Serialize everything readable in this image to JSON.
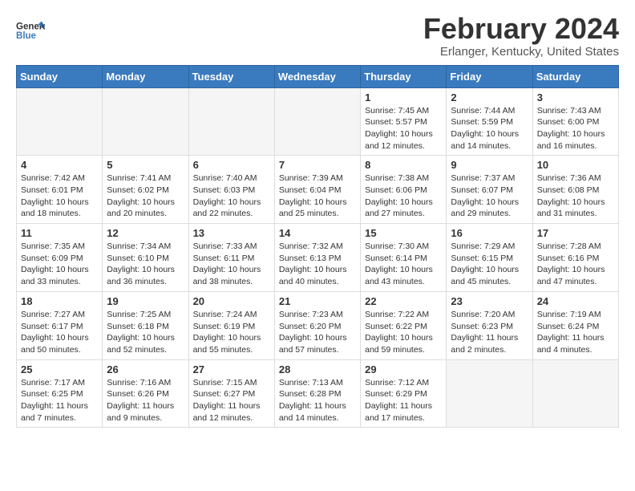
{
  "logo": {
    "general": "General",
    "blue": "Blue"
  },
  "header": {
    "title": "February 2024",
    "subtitle": "Erlanger, Kentucky, United States"
  },
  "weekdays": [
    "Sunday",
    "Monday",
    "Tuesday",
    "Wednesday",
    "Thursday",
    "Friday",
    "Saturday"
  ],
  "weeks": [
    [
      {
        "day": "",
        "empty": true
      },
      {
        "day": "",
        "empty": true
      },
      {
        "day": "",
        "empty": true
      },
      {
        "day": "",
        "empty": true
      },
      {
        "day": "1",
        "sunrise": "7:45 AM",
        "sunset": "5:57 PM",
        "daylight": "10 hours and 12 minutes."
      },
      {
        "day": "2",
        "sunrise": "7:44 AM",
        "sunset": "5:59 PM",
        "daylight": "10 hours and 14 minutes."
      },
      {
        "day": "3",
        "sunrise": "7:43 AM",
        "sunset": "6:00 PM",
        "daylight": "10 hours and 16 minutes."
      }
    ],
    [
      {
        "day": "4",
        "sunrise": "7:42 AM",
        "sunset": "6:01 PM",
        "daylight": "10 hours and 18 minutes."
      },
      {
        "day": "5",
        "sunrise": "7:41 AM",
        "sunset": "6:02 PM",
        "daylight": "10 hours and 20 minutes."
      },
      {
        "day": "6",
        "sunrise": "7:40 AM",
        "sunset": "6:03 PM",
        "daylight": "10 hours and 22 minutes."
      },
      {
        "day": "7",
        "sunrise": "7:39 AM",
        "sunset": "6:04 PM",
        "daylight": "10 hours and 25 minutes."
      },
      {
        "day": "8",
        "sunrise": "7:38 AM",
        "sunset": "6:06 PM",
        "daylight": "10 hours and 27 minutes."
      },
      {
        "day": "9",
        "sunrise": "7:37 AM",
        "sunset": "6:07 PM",
        "daylight": "10 hours and 29 minutes."
      },
      {
        "day": "10",
        "sunrise": "7:36 AM",
        "sunset": "6:08 PM",
        "daylight": "10 hours and 31 minutes."
      }
    ],
    [
      {
        "day": "11",
        "sunrise": "7:35 AM",
        "sunset": "6:09 PM",
        "daylight": "10 hours and 33 minutes."
      },
      {
        "day": "12",
        "sunrise": "7:34 AM",
        "sunset": "6:10 PM",
        "daylight": "10 hours and 36 minutes."
      },
      {
        "day": "13",
        "sunrise": "7:33 AM",
        "sunset": "6:11 PM",
        "daylight": "10 hours and 38 minutes."
      },
      {
        "day": "14",
        "sunrise": "7:32 AM",
        "sunset": "6:13 PM",
        "daylight": "10 hours and 40 minutes."
      },
      {
        "day": "15",
        "sunrise": "7:30 AM",
        "sunset": "6:14 PM",
        "daylight": "10 hours and 43 minutes."
      },
      {
        "day": "16",
        "sunrise": "7:29 AM",
        "sunset": "6:15 PM",
        "daylight": "10 hours and 45 minutes."
      },
      {
        "day": "17",
        "sunrise": "7:28 AM",
        "sunset": "6:16 PM",
        "daylight": "10 hours and 47 minutes."
      }
    ],
    [
      {
        "day": "18",
        "sunrise": "7:27 AM",
        "sunset": "6:17 PM",
        "daylight": "10 hours and 50 minutes."
      },
      {
        "day": "19",
        "sunrise": "7:25 AM",
        "sunset": "6:18 PM",
        "daylight": "10 hours and 52 minutes."
      },
      {
        "day": "20",
        "sunrise": "7:24 AM",
        "sunset": "6:19 PM",
        "daylight": "10 hours and 55 minutes."
      },
      {
        "day": "21",
        "sunrise": "7:23 AM",
        "sunset": "6:20 PM",
        "daylight": "10 hours and 57 minutes."
      },
      {
        "day": "22",
        "sunrise": "7:22 AM",
        "sunset": "6:22 PM",
        "daylight": "10 hours and 59 minutes."
      },
      {
        "day": "23",
        "sunrise": "7:20 AM",
        "sunset": "6:23 PM",
        "daylight": "11 hours and 2 minutes."
      },
      {
        "day": "24",
        "sunrise": "7:19 AM",
        "sunset": "6:24 PM",
        "daylight": "11 hours and 4 minutes."
      }
    ],
    [
      {
        "day": "25",
        "sunrise": "7:17 AM",
        "sunset": "6:25 PM",
        "daylight": "11 hours and 7 minutes."
      },
      {
        "day": "26",
        "sunrise": "7:16 AM",
        "sunset": "6:26 PM",
        "daylight": "11 hours and 9 minutes."
      },
      {
        "day": "27",
        "sunrise": "7:15 AM",
        "sunset": "6:27 PM",
        "daylight": "11 hours and 12 minutes."
      },
      {
        "day": "28",
        "sunrise": "7:13 AM",
        "sunset": "6:28 PM",
        "daylight": "11 hours and 14 minutes."
      },
      {
        "day": "29",
        "sunrise": "7:12 AM",
        "sunset": "6:29 PM",
        "daylight": "11 hours and 17 minutes."
      },
      {
        "day": "",
        "empty": true
      },
      {
        "day": "",
        "empty": true
      }
    ]
  ]
}
